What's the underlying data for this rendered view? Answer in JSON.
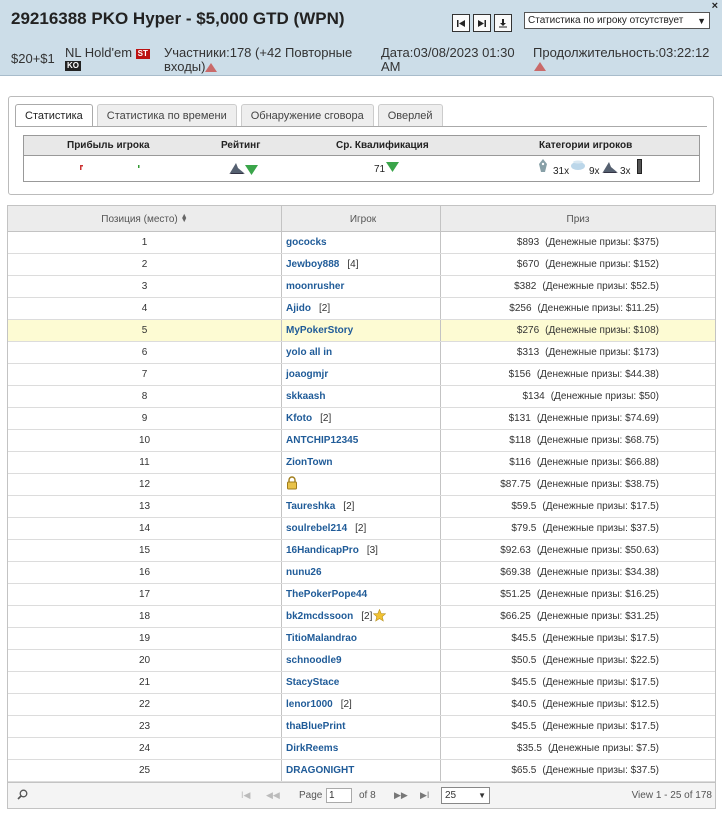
{
  "header": {
    "title": "29216388 PKO Hyper - $5,000 GTD (WPN)",
    "close": "×",
    "select_value": "Статистика по игроку отсутствует",
    "buyin": "$20+$1",
    "game_type": "NL Hold'em",
    "badge_st": "ST",
    "badge_ko": "KO",
    "participants": "Участники:178 (+42 Повторные входы)",
    "date": "Дата:03/08/2023 01:30 AM",
    "duration": "Продолжительность:03:22:12"
  },
  "stats_panel": {
    "tabs": [
      "Статистика",
      "Статистика по времени",
      "Обнаружение сговора",
      "Оверлей"
    ],
    "headers": {
      "profit": "Прибыль игрока",
      "rating": "Рейтинг",
      "avg_qual": "Ср. Квалификация",
      "categories": "Категории игроков"
    },
    "avg_qual_value": "71",
    "categories": {
      "a": "31x",
      "b": "9x",
      "c": "3x"
    }
  },
  "results": {
    "headers": {
      "position": "Позиция (место)",
      "player": "Игрок",
      "prize": "Приз"
    },
    "rows": [
      {
        "pos": "1",
        "player": "gococks",
        "count": "",
        "prize": "$893",
        "money": "(Денежные призы: $375)"
      },
      {
        "pos": "2",
        "player": "Jewboy888",
        "count": "[4]",
        "prize": "$670",
        "money": "(Денежные призы: $152)"
      },
      {
        "pos": "3",
        "player": "moonrusher",
        "count": "",
        "prize": "$382",
        "money": "(Денежные призы: $52.5)"
      },
      {
        "pos": "4",
        "player": "Ajido",
        "count": "[2]",
        "prize": "$256",
        "money": "(Денежные призы: $11.25)"
      },
      {
        "pos": "5",
        "player": "MyPokerStory",
        "count": "",
        "prize": "$276",
        "money": "(Денежные призы: $108)"
      },
      {
        "pos": "6",
        "player": "yolo all in",
        "count": "",
        "prize": "$313",
        "money": "(Денежные призы: $173)"
      },
      {
        "pos": "7",
        "player": "joaogmjr",
        "count": "",
        "prize": "$156",
        "money": "(Денежные призы: $44.38)"
      },
      {
        "pos": "8",
        "player": "skkaash",
        "count": "",
        "prize": "$134",
        "money": "(Денежные призы: $50)"
      },
      {
        "pos": "9",
        "player": "Kfoto",
        "count": "[2]",
        "prize": "$131",
        "money": "(Денежные призы: $74.69)"
      },
      {
        "pos": "10",
        "player": "ANTCHIP12345",
        "count": "",
        "prize": "$118",
        "money": "(Денежные призы: $68.75)"
      },
      {
        "pos": "11",
        "player": "ZionTown",
        "count": "",
        "prize": "$116",
        "money": "(Денежные призы: $66.88)"
      },
      {
        "pos": "12",
        "player": "",
        "count": "",
        "prize": "$87.75",
        "money": "(Денежные призы: $38.75)",
        "lock": true
      },
      {
        "pos": "13",
        "player": "Taureshka",
        "count": "[2]",
        "prize": "$59.5",
        "money": "(Денежные призы: $17.5)"
      },
      {
        "pos": "14",
        "player": "soulrebel214",
        "count": "[2]",
        "prize": "$79.5",
        "money": "(Денежные призы: $37.5)"
      },
      {
        "pos": "15",
        "player": "16HandicapPro",
        "count": "[3]",
        "prize": "$92.63",
        "money": "(Денежные призы: $50.63)"
      },
      {
        "pos": "16",
        "player": "nunu26",
        "count": "",
        "prize": "$69.38",
        "money": "(Денежные призы: $34.38)"
      },
      {
        "pos": "17",
        "player": "ThePokerPope44",
        "count": "",
        "prize": "$51.25",
        "money": "(Денежные призы: $16.25)"
      },
      {
        "pos": "18",
        "player": "bk2mcdssoon",
        "count": "[2]",
        "prize": "$66.25",
        "money": "(Денежные призы: $31.25)",
        "star": true
      },
      {
        "pos": "19",
        "player": "TitioMalandrao",
        "count": "",
        "prize": "$45.5",
        "money": "(Денежные призы: $17.5)"
      },
      {
        "pos": "20",
        "player": "schnoodle9",
        "count": "",
        "prize": "$50.5",
        "money": "(Денежные призы: $22.5)"
      },
      {
        "pos": "21",
        "player": "StacyStace",
        "count": "",
        "prize": "$45.5",
        "money": "(Денежные призы: $17.5)"
      },
      {
        "pos": "22",
        "player": "lenor1000",
        "count": "[2]",
        "prize": "$40.5",
        "money": "(Денежные призы: $12.5)"
      },
      {
        "pos": "23",
        "player": "thaBluePrint",
        "count": "",
        "prize": "$45.5",
        "money": "(Денежные призы: $17.5)"
      },
      {
        "pos": "24",
        "player": "DirkReems",
        "count": "",
        "prize": "$35.5",
        "money": "(Денежные призы: $7.5)"
      },
      {
        "pos": "25",
        "player": "DRAGONIGHT",
        "count": "",
        "prize": "$65.5",
        "money": "(Денежные призы: $37.5)"
      }
    ],
    "highlight_row": 5
  },
  "pager": {
    "page_label": "Page",
    "page_value": "1",
    "of_label": "of 8",
    "rows_per_page": "25",
    "view_range": "View 1 - 25 of 178"
  }
}
